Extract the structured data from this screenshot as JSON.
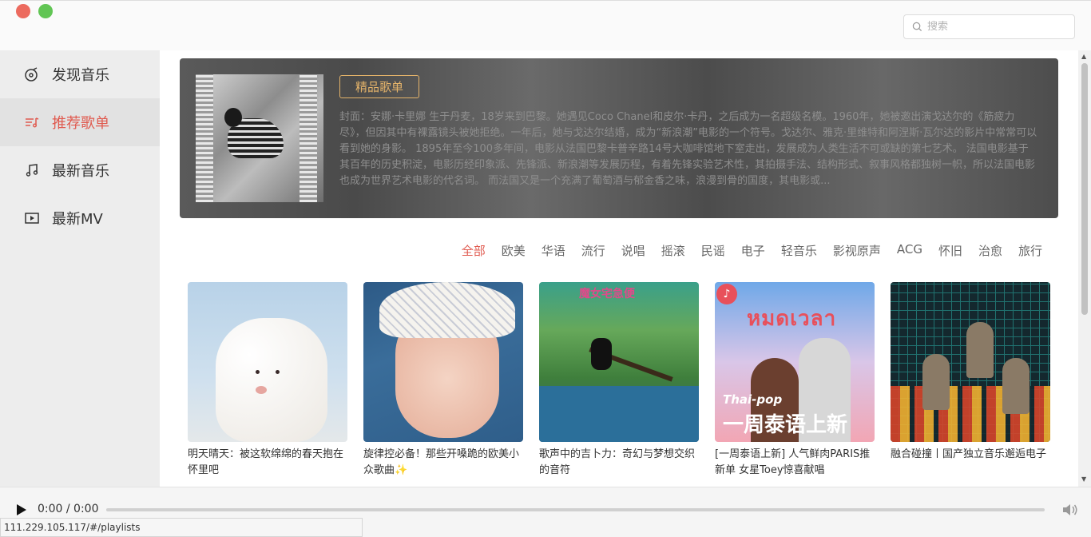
{
  "header": {
    "search_placeholder": "搜索"
  },
  "sidebar": {
    "items": [
      {
        "label": "发现音乐",
        "icon": "disc-icon",
        "active": false
      },
      {
        "label": "推荐歌单",
        "icon": "playlist-icon",
        "active": true
      },
      {
        "label": "最新音乐",
        "icon": "music-note-icon",
        "active": false
      },
      {
        "label": "最新MV",
        "icon": "video-icon",
        "active": false
      }
    ]
  },
  "banner": {
    "tag": "精品歌单",
    "description": "封面：安娜·卡里娜 生于丹麦，18岁来到巴黎。她遇见Coco Chanel和皮尔·卡丹，之后成为一名超级名模。1960年，她被邀出演戈达尔的《筋疲力尽》，但因其中有裸露镜头被她拒绝。一年后，她与戈达尔结婚，成为“新浪潮”电影的一个符号。戈达尔、雅克·里维特和阿涅斯·瓦尔达的影片中常常可以看到她的身影。 1895年至今100多年间，电影从法国巴黎卡普辛路14号大咖啡馆地下室走出，发展成为人类生活不可或缺的第七艺术。 法国电影基于其百年的历史积淀，电影历经印象派、先锋派、新浪潮等发展历程，有着先锋实验艺术性，其拍摄手法、结构形式、叙事风格都独树一帜，所以法国电影也成为世界艺术电影的代名词。 而法国又是一个充满了葡萄酒与郁金香之味，浪漫到骨的国度，其电影或..."
  },
  "categories": [
    "全部",
    "欧美",
    "华语",
    "流行",
    "说唱",
    "摇滚",
    "民谣",
    "电子",
    "轻音乐",
    "影视原声",
    "ACG",
    "怀旧",
    "治愈",
    "旅行"
  ],
  "active_category": "全部",
  "playlists": [
    {
      "title": "明天晴天：被这软绵绵的春天抱在怀里吧"
    },
    {
      "title": "旋律控必备！那些开嗓跪的欧美小众歌曲✨"
    },
    {
      "title": "歌声中的吉卜力：奇幻与梦想交织的音符",
      "cover_text": "魔女宅急便"
    },
    {
      "title": "[一周泰语上新] 人气鲜肉PARIS推新单 女星Toey惊喜献唱",
      "cover_text": "Thai-pop",
      "cover_big": "一周泰语上新",
      "cover_band": "หมดเวลา"
    },
    {
      "title": "融合碰撞丨国产独立音乐邂逅电子"
    }
  ],
  "player": {
    "time": "0:00 / 0:00",
    "progress": 0
  },
  "status_bar": {
    "url": "111.229.105.117/#/playlists"
  },
  "colors": {
    "accent": "#e05a4f",
    "tag": "#e4b36a"
  }
}
